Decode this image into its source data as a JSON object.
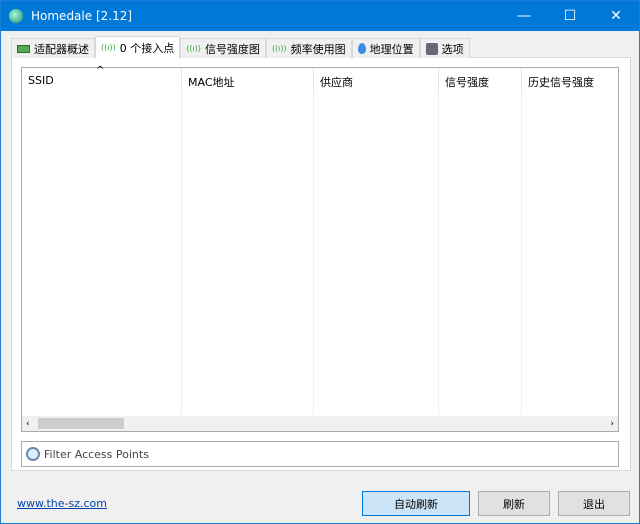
{
  "window": {
    "title": "Homedale [2.12]",
    "minimize": "—",
    "maximize": "☐",
    "close": "✕"
  },
  "tabs": [
    {
      "label": "适配器概述",
      "icon": "adapter-icon"
    },
    {
      "label": "0 个接入点",
      "icon": "antenna-icon"
    },
    {
      "label": "信号强度图",
      "icon": "antenna-icon"
    },
    {
      "label": "频率使用图",
      "icon": "antenna-icon"
    },
    {
      "label": "地理位置",
      "icon": "location-pin-icon"
    },
    {
      "label": "选项",
      "icon": "options-icon"
    }
  ],
  "list": {
    "columns": [
      "SSID",
      "MAC地址",
      "供应商",
      "信号强度",
      "历史信号强度"
    ],
    "sort_indicator": "^"
  },
  "filter": {
    "placeholder": "Filter Access Points"
  },
  "footer": {
    "link": "www.the-sz.com",
    "auto_refresh": "自动刷新",
    "refresh": "刷新",
    "exit": "退出"
  },
  "colors": {
    "titlebar": "#0078d7",
    "primary_button": "#cce4f7"
  }
}
